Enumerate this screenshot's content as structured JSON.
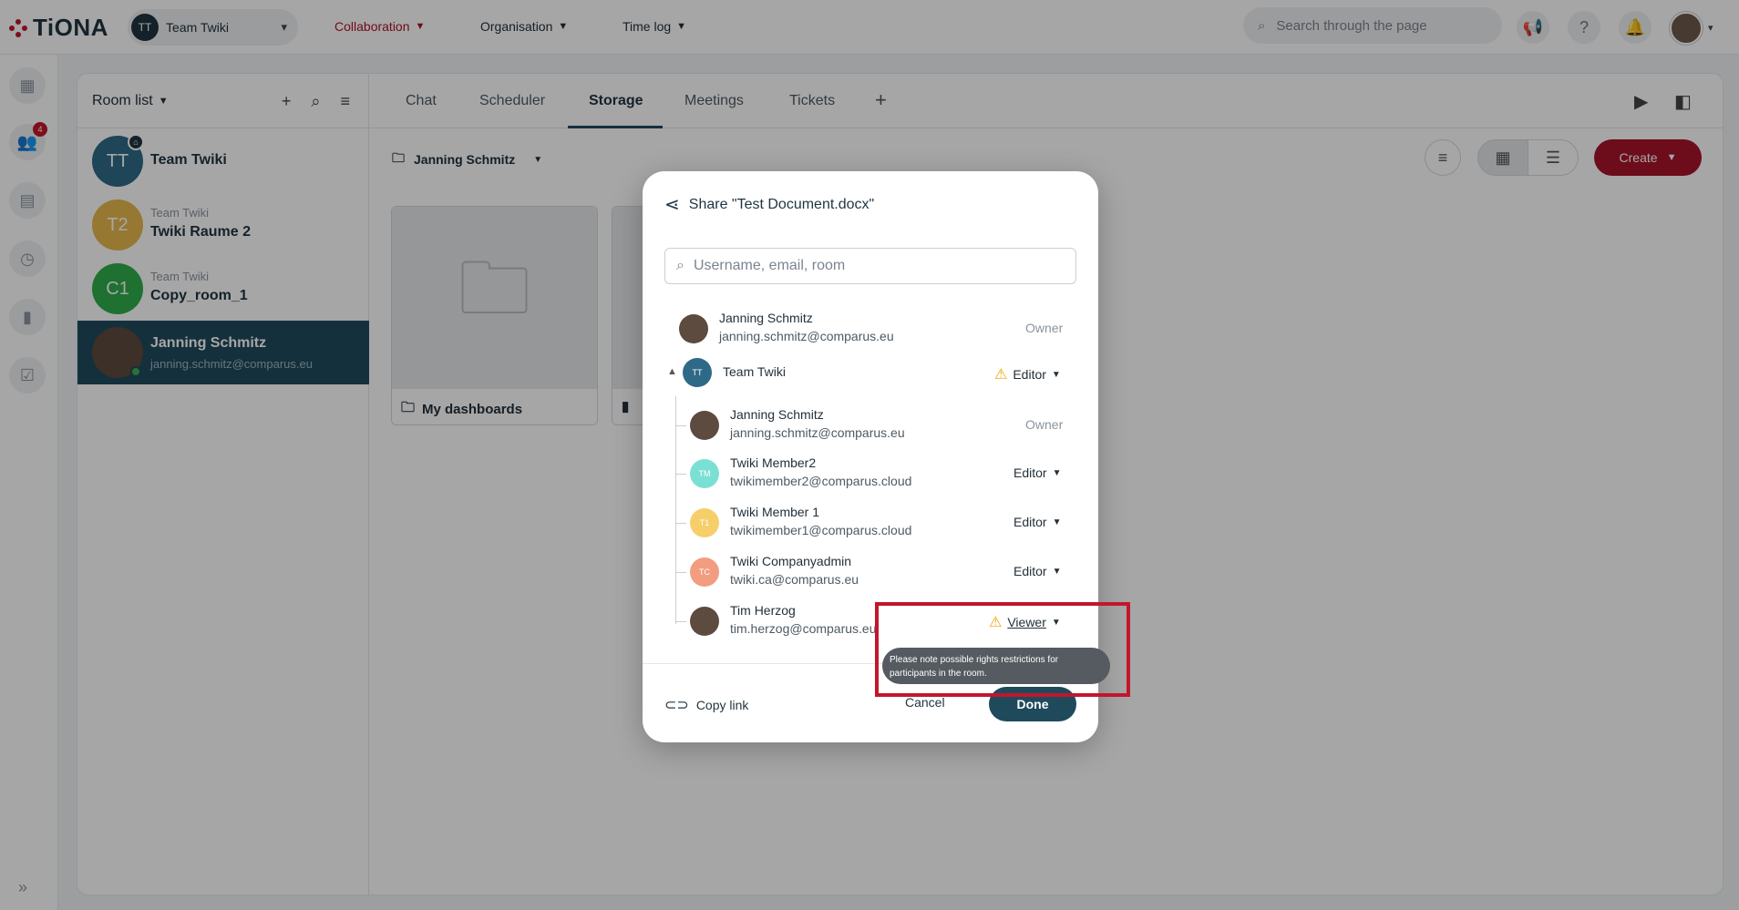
{
  "app": {
    "logo_text": "TiONA"
  },
  "team_selector": {
    "initials": "TT",
    "label": "Team Twiki"
  },
  "nav": [
    {
      "label": "Collaboration",
      "active": true
    },
    {
      "label": "Organisation",
      "active": false
    },
    {
      "label": "Time log",
      "active": false
    }
  ],
  "top_search": {
    "placeholder": "Search through the page"
  },
  "rail": {
    "badge_count": "4"
  },
  "room_list": {
    "title": "Room list",
    "rooms": [
      {
        "initials": "TT",
        "sub": "",
        "name": "Team Twiki",
        "color": "#2e6a87"
      },
      {
        "initials": "T2",
        "sub": "Team Twiki",
        "name": "Twiki Raume 2",
        "color": "#e6b84f"
      },
      {
        "initials": "C1",
        "sub": "Team Twiki",
        "name": "Copy_room_1",
        "color": "#2fae4a"
      },
      {
        "initials": "",
        "sub": "janning.schmitz@comparus.eu",
        "name": "Janning Schmitz",
        "color": "#5c4b3e"
      }
    ]
  },
  "tabs": [
    "Chat",
    "Scheduler",
    "Storage",
    "Meetings",
    "Tickets"
  ],
  "active_tab": "Storage",
  "breadcrumb": {
    "label": "Janning Schmitz"
  },
  "create_button": {
    "label": "Create"
  },
  "tiles": [
    {
      "label": "My dashboards"
    }
  ],
  "dialog": {
    "title": "Share \"Test Document.docx\"",
    "search_placeholder": "Username, email, room",
    "members": [
      {
        "name": "Janning Schmitz",
        "email": "janning.schmitz@comparus.eu",
        "role": "Owner"
      },
      {
        "name": "Team Twiki",
        "email": "",
        "role": "Editor",
        "initials": "TT",
        "color": "#2e6a87"
      },
      {
        "name": "Janning Schmitz",
        "email": "janning.schmitz@comparus.eu",
        "role": "Owner"
      },
      {
        "name": "Twiki Member2",
        "email": "twikimember2@comparus.cloud",
        "role": "Editor",
        "initials": "TM",
        "color": "#7be0d4"
      },
      {
        "name": "Twiki Member 1",
        "email": "twikimember1@comparus.cloud",
        "role": "Editor",
        "initials": "T1",
        "color": "#f6cf6b"
      },
      {
        "name": "Twiki Companyadmin",
        "email": "twiki.ca@comparus.eu",
        "role": "Editor",
        "initials": "TC",
        "color": "#f29c80"
      },
      {
        "name": "Tim Herzog",
        "email": "tim.herzog@comparus.eu",
        "role": "Viewer"
      }
    ],
    "copy_link_label": "Copy link",
    "cancel_label": "Cancel",
    "done_label": "Done",
    "tooltip": "Please note possible rights restrictions for participants in the room."
  },
  "colors": {
    "accent": "#a8132a",
    "primary": "#1f4a5c",
    "warning": "#f0a500"
  }
}
